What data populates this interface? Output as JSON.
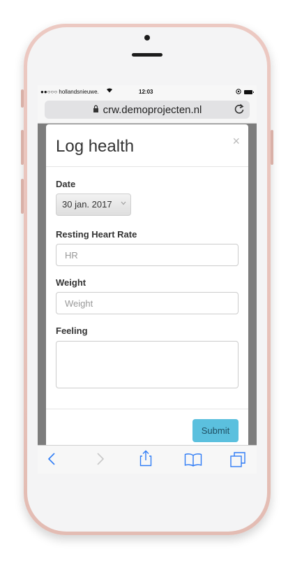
{
  "status_bar": {
    "carrier": "●●○○○ hollandsnieuwe.",
    "wifi_icon": "wifi-icon",
    "time": "12:03",
    "location_icon": "location-icon",
    "battery_icon": "battery-icon"
  },
  "browser": {
    "url": "crw.demoprojecten.nl",
    "lock_icon": "lock-icon",
    "reload_icon": "reload-icon"
  },
  "modal": {
    "title": "Log health",
    "close_label": "×",
    "date_label": "Date",
    "date_value": "30 jan. 2017",
    "hr_label": "Resting Heart Rate",
    "hr_placeholder": "HR",
    "weight_label": "Weight",
    "weight_placeholder": "Weight",
    "feeling_label": "Feeling",
    "submit_label": "Submit"
  },
  "toolbar": {
    "back_icon": "back-icon",
    "forward_icon": "forward-icon",
    "share_icon": "share-icon",
    "bookmarks_icon": "bookmarks-icon",
    "tabs_icon": "tabs-icon"
  },
  "colors": {
    "phone_body": "#e8c3bb",
    "submit_button": "#5bc0de",
    "toolbar_accent": "#2f7cf6"
  }
}
